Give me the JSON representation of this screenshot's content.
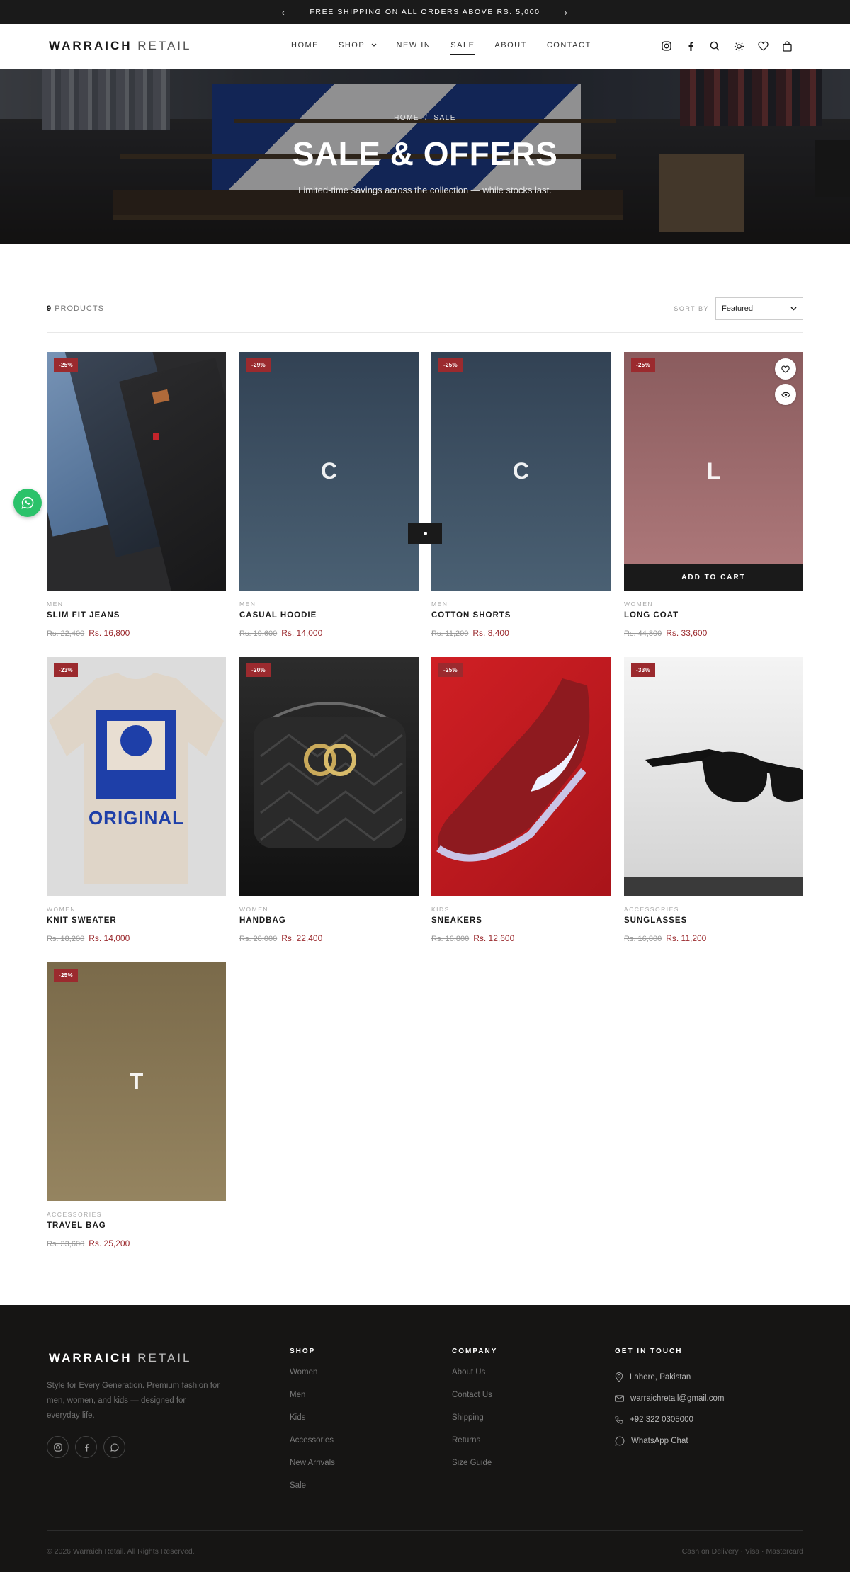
{
  "announcement": {
    "text": "FREE SHIPPING ON ALL ORDERS ABOVE RS. 5,000",
    "prev": "‹",
    "next": "›"
  },
  "header": {
    "brand_bold": "WARRAICH",
    "brand_light": "RETAIL",
    "nav": [
      "HOME",
      "SHOP",
      "NEW IN",
      "SALE",
      "ABOUT",
      "CONTACT"
    ],
    "active_nav": "SALE",
    "icons": [
      "instagram-icon",
      "facebook-icon",
      "search-icon",
      "theme-toggle-icon",
      "wishlist-icon",
      "cart-icon"
    ]
  },
  "hero": {
    "crumb_home": "HOME",
    "crumb_sep": "/",
    "crumb_current": "SALE",
    "title": "SALE & OFFERS",
    "subtitle": "Limited-time savings across the collection — while stocks last."
  },
  "toolbar": {
    "count": "9",
    "count_label": "PRODUCTS",
    "sort_label": "SORT BY",
    "sort_value": "Featured"
  },
  "products": [
    {
      "badge": "-25%",
      "category": "MEN",
      "name": "SLIM FIT JEANS",
      "old_price": "Rs. 22,400",
      "price": "Rs. 16,800"
    },
    {
      "badge": "-29%",
      "category": "MEN",
      "name": "CASUAL HOODIE",
      "old_price": "Rs. 19,600",
      "price": "Rs. 14,000",
      "letter": "C"
    },
    {
      "badge": "-25%",
      "category": "MEN",
      "name": "COTTON SHORTS",
      "old_price": "Rs. 11,200",
      "price": "Rs. 8,400",
      "letter": "C"
    },
    {
      "badge": "-25%",
      "category": "WOMEN",
      "name": "LONG COAT",
      "old_price": "Rs. 44,800",
      "price": "Rs. 33,600",
      "letter": "L",
      "add_to_cart": "ADD TO CART"
    },
    {
      "badge": "-23%",
      "category": "WOMEN",
      "name": "KNIT SWEATER",
      "old_price": "Rs. 18,200",
      "price": "Rs. 14,000",
      "shirt_text": "ORIGINAL"
    },
    {
      "badge": "-20%",
      "category": "WOMEN",
      "name": "HANDBAG",
      "old_price": "Rs. 28,000",
      "price": "Rs. 22,400"
    },
    {
      "badge": "-25%",
      "category": "KIDS",
      "name": "SNEAKERS",
      "old_price": "Rs. 16,800",
      "price": "Rs. 12,600"
    },
    {
      "badge": "-33%",
      "category": "ACCESSORIES",
      "name": "SUNGLASSES",
      "old_price": "Rs. 16,800",
      "price": "Rs. 11,200"
    },
    {
      "badge": "-25%",
      "category": "ACCESSORIES",
      "name": "TRAVEL BAG",
      "old_price": "Rs. 33,600",
      "price": "Rs. 25,200",
      "letter": "T"
    }
  ],
  "footer": {
    "brand_bold": "WARRAICH",
    "brand_light": "RETAIL",
    "tagline": "Style for Every Generation. Premium fashion for men, women, and kids — designed for everyday life.",
    "shop_title": "SHOP",
    "shop_links": [
      "Women",
      "Men",
      "Kids",
      "Accessories",
      "New Arrivals",
      "Sale"
    ],
    "company_title": "COMPANY",
    "company_links": [
      "About Us",
      "Contact Us",
      "Shipping",
      "Returns",
      "Size Guide"
    ],
    "contact_title": "GET IN TOUCH",
    "location": "Lahore, Pakistan",
    "email": "warraichretail@gmail.com",
    "phone": "+92 322 0305000",
    "whatsapp": "WhatsApp Chat",
    "copyright": "© 2026 Warraich Retail. All Rights Reserved.",
    "payments": "Cash on Delivery · Visa · Mastercard"
  },
  "colors": {
    "accent": "#9b2a2e",
    "dark": "#1a1a1a",
    "footer_bg": "#161514",
    "whatsapp": "#2bc26a"
  }
}
